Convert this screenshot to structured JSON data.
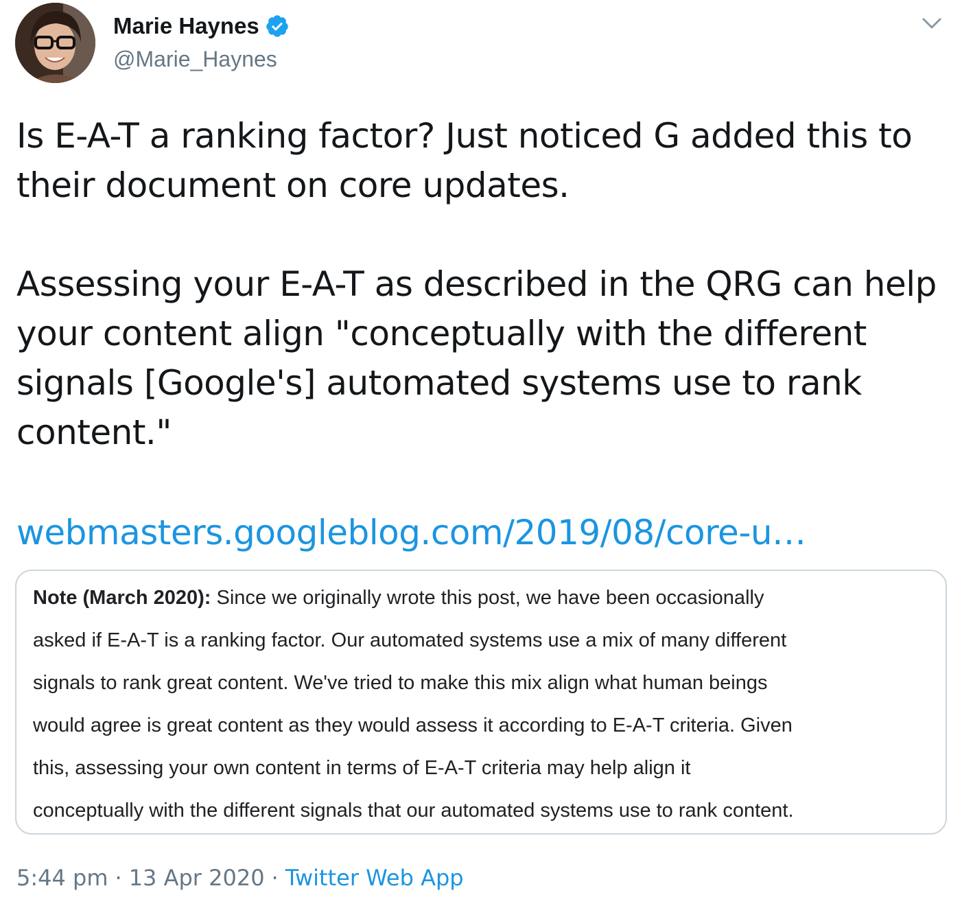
{
  "author": {
    "display_name": "Marie Haynes",
    "handle": "@Marie_Haynes",
    "verified": true,
    "avatar_icon": "profile-photo"
  },
  "tweet": {
    "paragraphs": [
      "Is E-A-T a ranking factor? Just noticed G added this to their document on core updates.",
      "Assessing your E-A-T as described in the QRG can help your content align \"conceptually with the different signals [Google's] automated systems use to rank content.\""
    ],
    "link_text": "webmasters.googleblog.com/2019/08/core-u…"
  },
  "card": {
    "note_label": "Note (March 2020):",
    "note_lines": [
      " Since we originally wrote this post, we have been occasionally",
      "asked if E-A-T is a ranking factor. Our automated systems use a mix of many different",
      "signals to rank great content. We've tried to make this mix align what human beings",
      "would agree is great content as they would assess it according to E-A-T criteria. Given",
      "this, assessing your own content in terms of E-A-T criteria may help align it",
      "conceptually with the different signals that our automated systems use to rank content."
    ]
  },
  "meta": {
    "time": "5:44 pm",
    "separator": "·",
    "date": "13 Apr 2020",
    "source": "Twitter Web App"
  },
  "colors": {
    "link": "#1b95e0",
    "text": "#14171a",
    "secondary": "#657786",
    "border": "#ccd6dd",
    "verified": "#1da1f2"
  }
}
